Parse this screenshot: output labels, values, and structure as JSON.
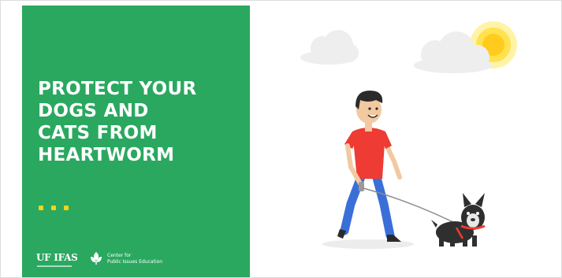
{
  "headline": [
    "PROTECT YOUR",
    "DOGS AND",
    "CATS FROM",
    "HEARTWORM"
  ],
  "logos": {
    "ufifas": "UF IFAS",
    "center_line1": "Center for",
    "center_line2": "Public Issues Education"
  },
  "colors": {
    "panel_green": "#2aa860",
    "accent_yellow": "#f2d41a",
    "shirt_red": "#ee3b33",
    "jeans_blue": "#3a6fd8",
    "sun_yellow": "#ffe24d"
  },
  "icons": [
    "sun-icon",
    "cloud-icon",
    "leaf-icon"
  ]
}
